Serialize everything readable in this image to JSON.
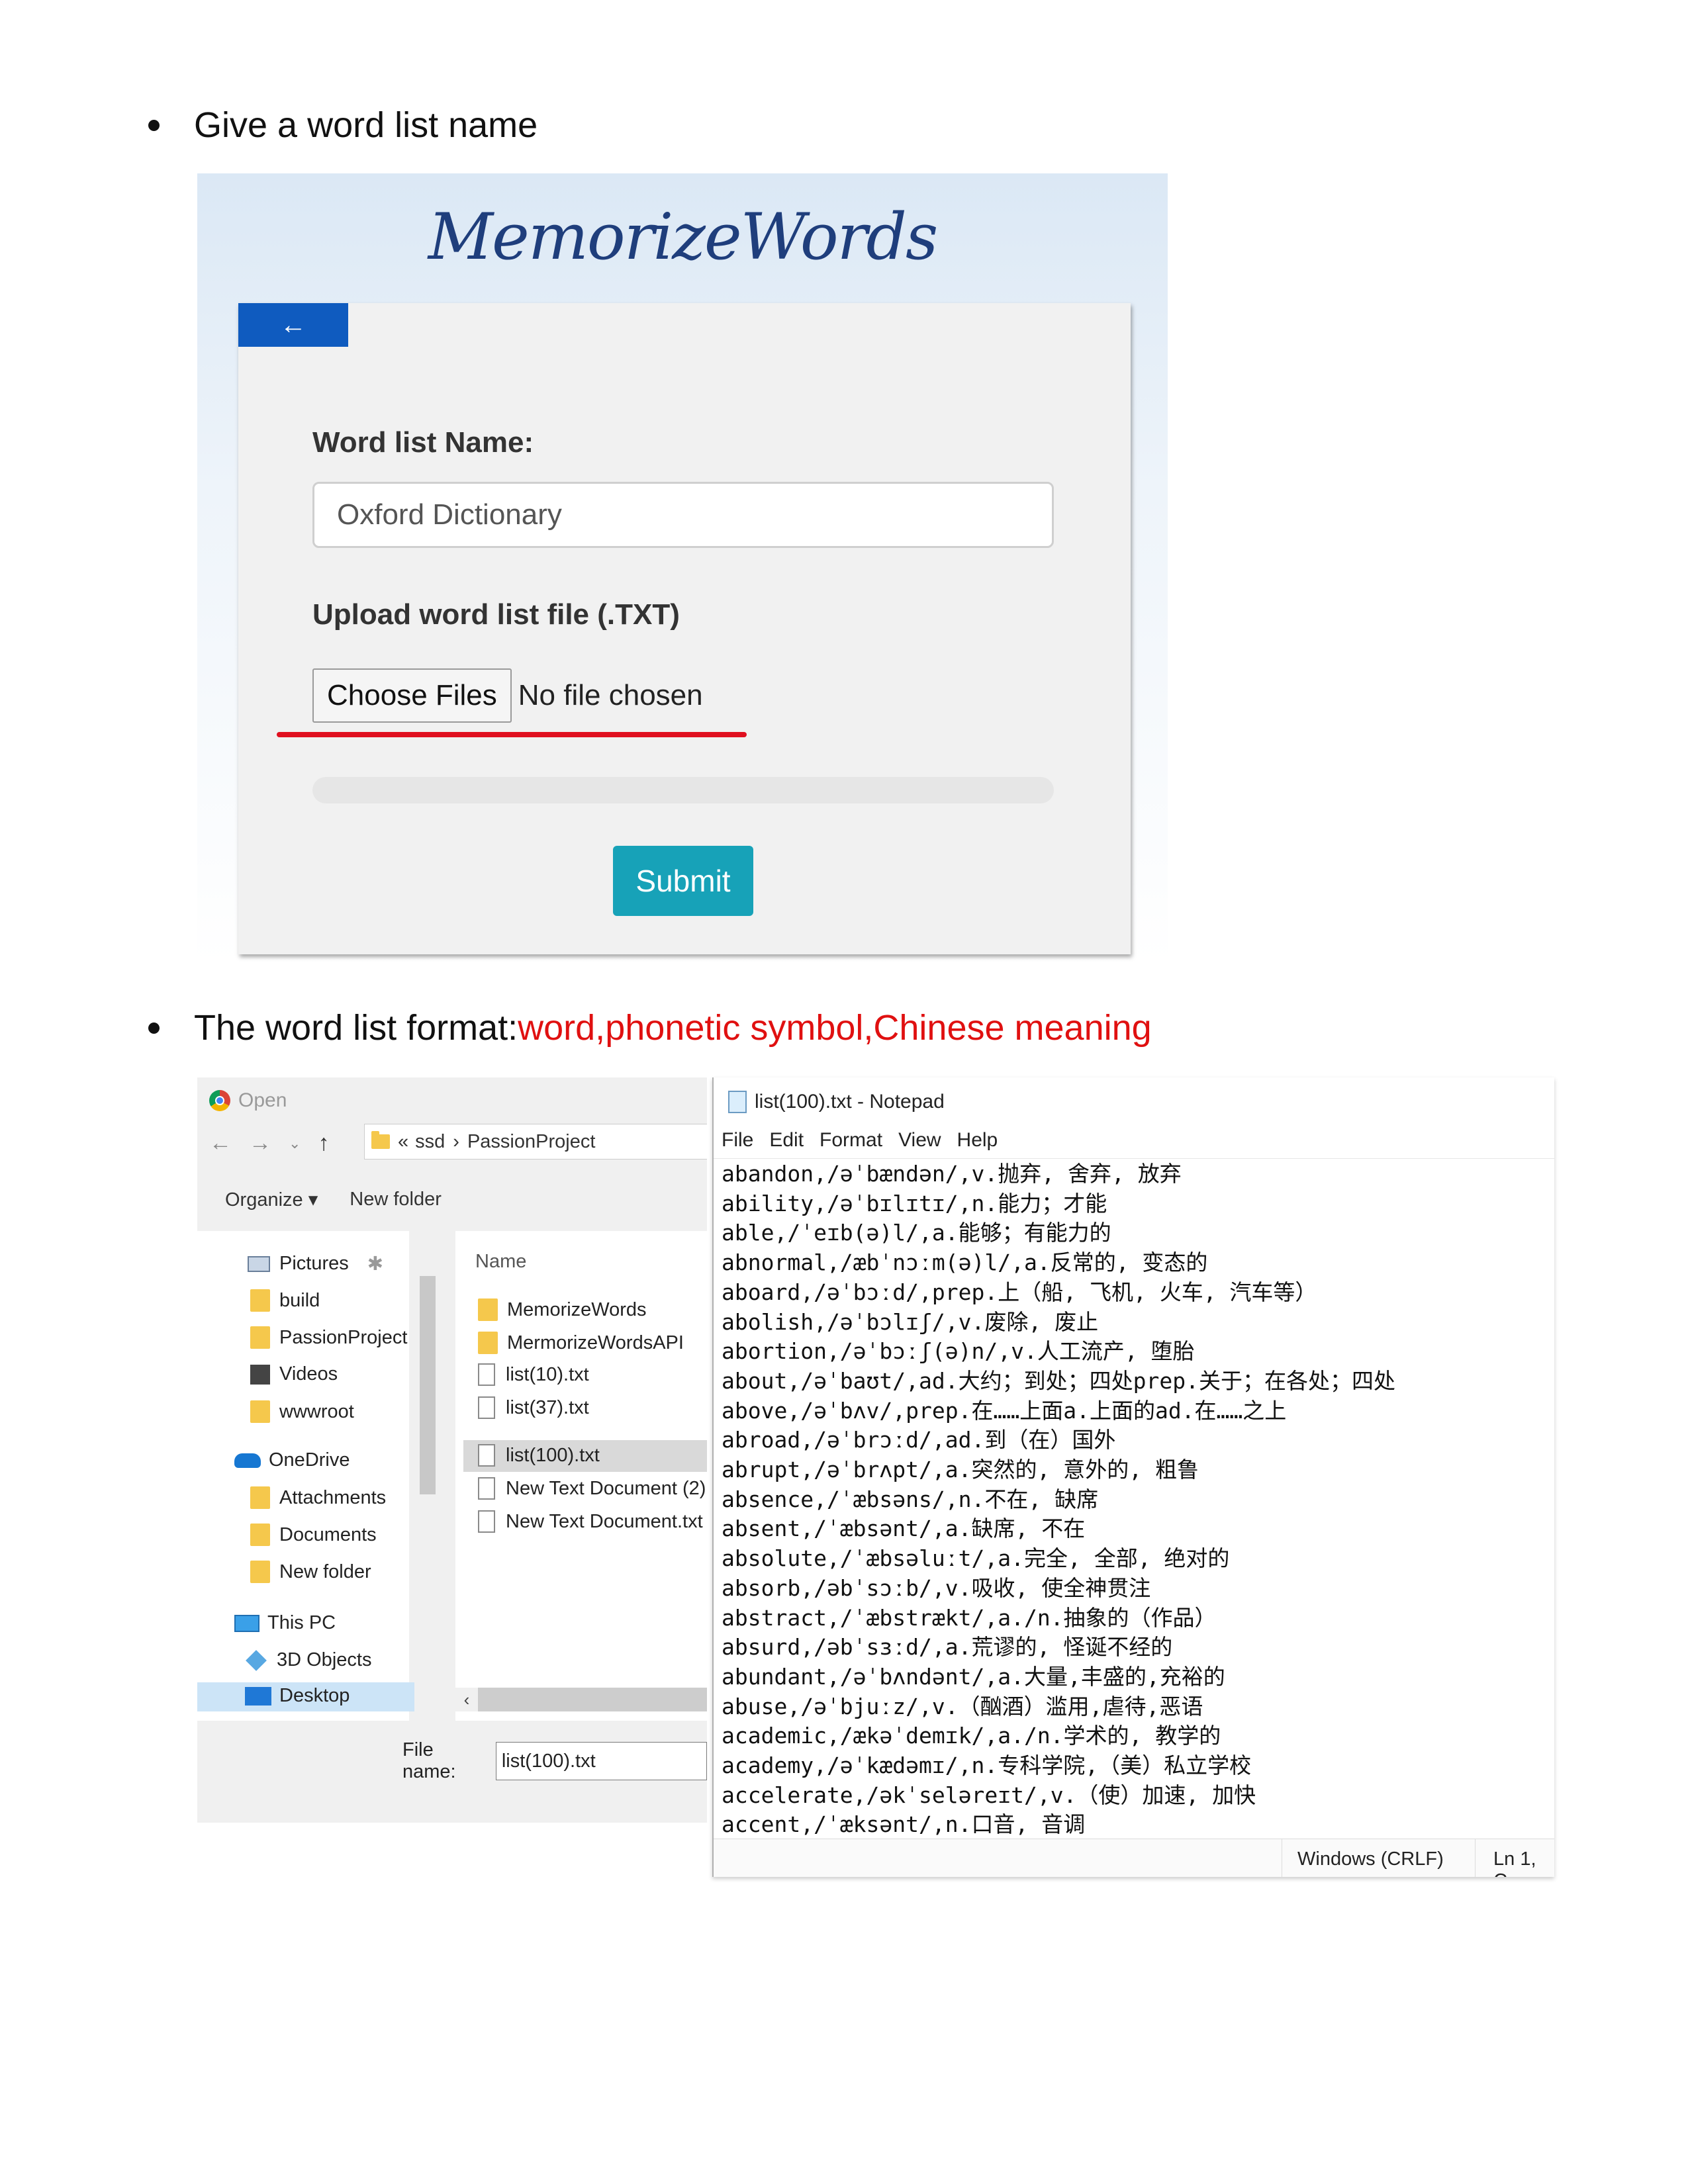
{
  "section1": {
    "heading": "Give a word list name"
  },
  "form": {
    "logo_text": "MemorizeWords",
    "back_label": "←",
    "name_label": "Word list Name:",
    "name_value": "Oxford Dictionary",
    "upload_label": "Upload word list file (.TXT)",
    "choose_label": "Choose Files",
    "no_file_text": "No file chosen",
    "submit_label": "Submit",
    "colors": {
      "back": "#0f5bbf",
      "submit": "#17a2b8",
      "highlight": "#e01020"
    }
  },
  "section2": {
    "heading_prefix": "The word list format: ",
    "heading_red": "word,phonetic symbol,Chinese meaning"
  },
  "file_dialog": {
    "title": "Open",
    "nav_icons": [
      "back-arrow-icon",
      "forward-arrow-icon",
      "chevron-down-icon",
      "up-arrow-icon"
    ],
    "address": {
      "sep": "«",
      "path1": "ssd",
      "arrow": "›",
      "path2": "PassionProject"
    },
    "organize_label": "Organize ▾",
    "new_folder_label": "New folder",
    "tree": [
      "Pictures",
      "build",
      "PassionProject",
      "Videos",
      "wwwroot",
      "OneDrive",
      "Attachments",
      "Documents",
      "New folder",
      "This PC",
      "3D Objects",
      "Desktop"
    ],
    "column_name": "Name",
    "files": [
      "MemorizeWords",
      "MermorizeWordsAPI",
      "list(10).txt",
      "list(37).txt",
      "list(100).txt",
      "New Text Document (2).",
      "New Text Document.txt"
    ],
    "file_name_label": "File name:",
    "file_name_value": "list(100).txt"
  },
  "notepad": {
    "title": "list(100).txt - Notepad",
    "menu": [
      "File",
      "Edit",
      "Format",
      "View",
      "Help"
    ],
    "lines": [
      "abandon,/əˈbændən/,v.抛弃, 舍弃, 放弃",
      "ability,/əˈbɪlɪtɪ/,n.能力；才能",
      "able,/ˈeɪb(ə)l/,a.能够；有能力的",
      "abnormal,/æbˈnɔːm(ə)l/,a.反常的, 变态的",
      "aboard,/əˈbɔːd/,prep.上（船, 飞机, 火车, 汽车等）",
      "abolish,/əˈbɔlɪʃ/,v.废除, 废止",
      "abortion,/əˈbɔːʃ(ə)n/,v.人工流产, 堕胎",
      "about,/əˈbaʊt/,ad.大约；到处；四处prep.关于；在各处；四处",
      "above,/əˈbʌv/,prep.在……上面a.上面的ad.在……之上",
      "abroad,/əˈbrɔːd/,ad.到（在）国外",
      "abrupt,/əˈbrʌpt/,a.突然的, 意外的, 粗鲁",
      "absence,/ˈæbsəns/,n.不在, 缺席",
      "absent,/ˈæbsənt/,a.缺席, 不在",
      "absolute,/ˈæbsəluːt/,a.完全, 全部, 绝对的",
      "absorb,/əbˈsɔːb/,v.吸收, 使全神贯注",
      "abstract,/ˈæbstrækt/,a./n.抽象的（作品）",
      "absurd,/əbˈsɜːd/,a.荒谬的, 怪诞不经的",
      "abundant,/əˈbʌndənt/,a.大量,丰盛的,充裕的",
      "abuse,/əˈbjuːz/,v.（酗酒）滥用,虐待,恶语",
      "academic,/ækəˈdemɪk/,a./n.学术的, 教学的",
      "academy,/əˈkædəmɪ/,n.专科学院,（美）私立学校",
      "accelerate,/əkˈseləreɪt/,v.（使）加速, 加快",
      "accent,/ˈæksənt/,n.口音, 音调"
    ],
    "status_encoding": "Windows (CRLF)",
    "status_position": "Ln 1, C"
  }
}
